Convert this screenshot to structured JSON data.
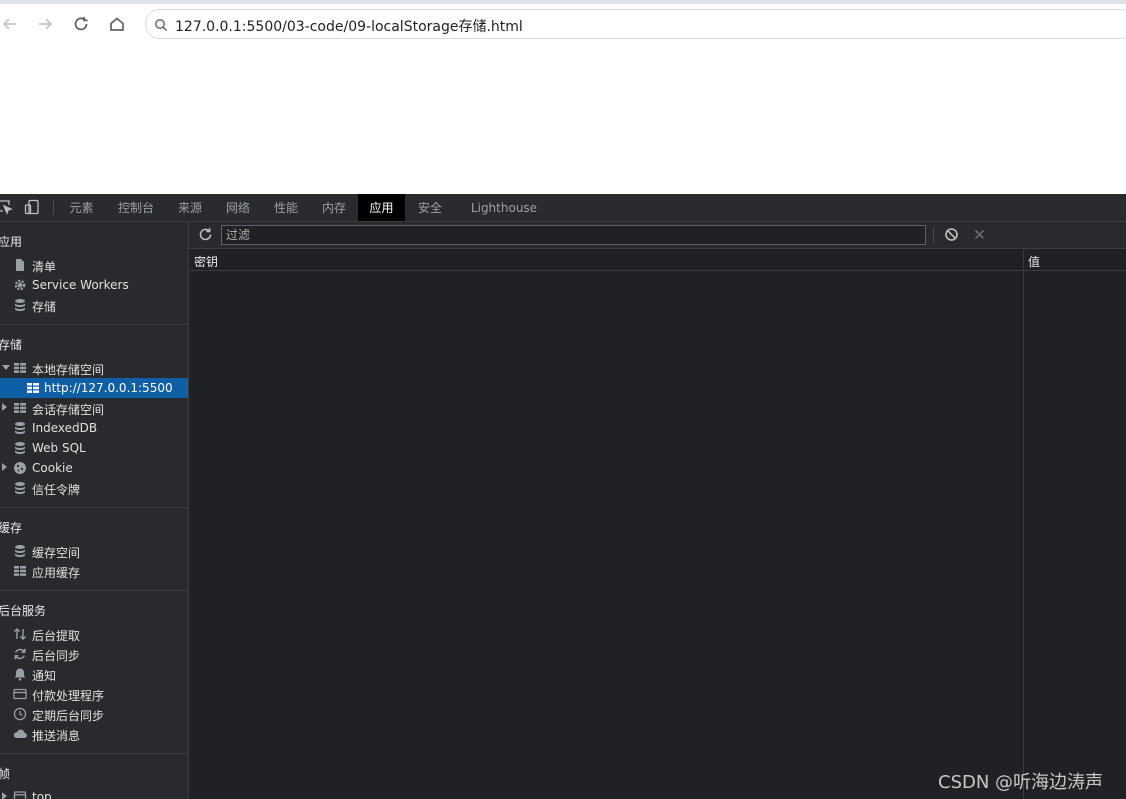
{
  "browser": {
    "url": "127.0.0.1:5500/03-code/09-localStorage存储.html"
  },
  "devtools": {
    "tabs": [
      {
        "label": "元素"
      },
      {
        "label": "控制台"
      },
      {
        "label": "来源"
      },
      {
        "label": "网络"
      },
      {
        "label": "性能"
      },
      {
        "label": "内存"
      },
      {
        "label": "应用"
      },
      {
        "label": "安全"
      },
      {
        "label": "Lighthouse"
      }
    ],
    "active_tab": "应用",
    "sidebar": {
      "sections": [
        {
          "title": "应用",
          "items": [
            {
              "label": "清单",
              "icon": "file-icon"
            },
            {
              "label": "Service Workers",
              "icon": "gear-icon"
            },
            {
              "label": "存储",
              "icon": "database-icon"
            }
          ]
        },
        {
          "title": "存储",
          "items": [
            {
              "label": "本地存储空间",
              "icon": "grid-icon",
              "expanded": true
            },
            {
              "label": "http://127.0.0.1:5500",
              "icon": "grid-icon",
              "selected": true
            },
            {
              "label": "会话存储空间",
              "icon": "grid-icon",
              "expanded": false
            },
            {
              "label": "IndexedDB",
              "icon": "database-icon"
            },
            {
              "label": "Web SQL",
              "icon": "database-icon"
            },
            {
              "label": "Cookie",
              "icon": "cookie-icon",
              "expanded": false
            },
            {
              "label": "信任令牌",
              "icon": "database-icon"
            }
          ]
        },
        {
          "title": "缓存",
          "items": [
            {
              "label": "缓存空间",
              "icon": "database-icon"
            },
            {
              "label": "应用缓存",
              "icon": "grid-icon"
            }
          ]
        },
        {
          "title": "后台服务",
          "items": [
            {
              "label": "后台提取",
              "icon": "arrows-up-down-icon"
            },
            {
              "label": "后台同步",
              "icon": "sync-icon"
            },
            {
              "label": "通知",
              "icon": "bell-icon"
            },
            {
              "label": "付款处理程序",
              "icon": "card-icon"
            },
            {
              "label": "定期后台同步",
              "icon": "clock-icon"
            },
            {
              "label": "推送消息",
              "icon": "cloud-icon"
            }
          ]
        },
        {
          "title": "帧",
          "items": [
            {
              "label": "top",
              "icon": "frame-icon",
              "expanded": false
            }
          ]
        }
      ]
    },
    "main": {
      "filter_placeholder": "过滤",
      "columns": {
        "key": "密钥",
        "value": "值"
      }
    }
  },
  "watermark": "CSDN @听海边涛声",
  "colors": {
    "devtools_bg": "#202124",
    "sidebar_bg": "#292a2d",
    "selected_bg": "#0f5fa6",
    "active_tab_bg": "#000000"
  }
}
